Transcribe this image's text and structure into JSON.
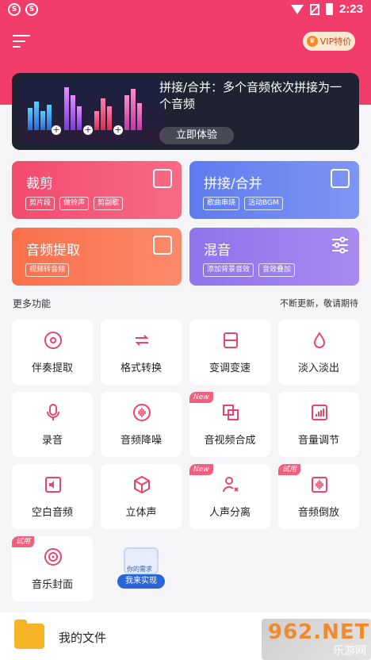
{
  "statusbar": {
    "time": "2:23"
  },
  "header": {
    "vip_label": "VIP特价"
  },
  "banner": {
    "text": "拼接/合并：多个音频依次拼接为一个音频",
    "button": "立即体验"
  },
  "cards": [
    {
      "title": "裁剪",
      "tags": [
        "剪片段",
        "做铃声",
        "剪副歌"
      ]
    },
    {
      "title": "拼接/合并",
      "tags": [
        "歌曲串烧",
        "活动BGM"
      ]
    },
    {
      "title": "音频提取",
      "tags": [
        "视频转音频"
      ]
    },
    {
      "title": "混音",
      "tags": [
        "添加背景音效",
        "音效叠加"
      ]
    }
  ],
  "more": {
    "title": "更多功能",
    "note": "不断更新，敬请期待"
  },
  "tools": [
    {
      "label": "伴奏提取",
      "badge": ""
    },
    {
      "label": "格式转换",
      "badge": ""
    },
    {
      "label": "变调变速",
      "badge": ""
    },
    {
      "label": "淡入淡出",
      "badge": ""
    },
    {
      "label": "录音",
      "badge": ""
    },
    {
      "label": "音频降噪",
      "badge": ""
    },
    {
      "label": "音视频合成",
      "badge": "New"
    },
    {
      "label": "音量调节",
      "badge": ""
    },
    {
      "label": "空白音频",
      "badge": ""
    },
    {
      "label": "立体声",
      "badge": ""
    },
    {
      "label": "人声分离",
      "badge": "New"
    },
    {
      "label": "音频倒放",
      "badge": "试用"
    },
    {
      "label": "音乐封面",
      "badge": "试用"
    }
  ],
  "wish": {
    "top": "你的需求",
    "button": "我来实现"
  },
  "filebar": {
    "label": "我的文件"
  },
  "watermark": {
    "main": "962.NET",
    "sub": "乐游网"
  },
  "colors": {
    "brand": "#f23d6a",
    "icon": "#e8456e",
    "card_cut": "#f3476f",
    "card_merge": "#6d84f2",
    "card_extract": "#fa7a4f",
    "card_mix": "#9a79ec"
  }
}
